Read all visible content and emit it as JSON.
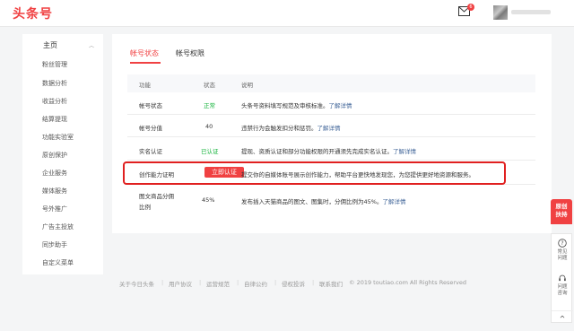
{
  "header": {
    "logo": "头条号",
    "mail_badge": "6"
  },
  "sidebar": {
    "head": "主页",
    "items": [
      {
        "label": "粉丝管理"
      },
      {
        "label": "数据分析"
      },
      {
        "label": "收益分析"
      },
      {
        "label": "结算提现"
      },
      {
        "label": "功能实验室"
      },
      {
        "label": "原创保护"
      },
      {
        "label": "企业服务"
      },
      {
        "label": "媒体服务"
      },
      {
        "label": "号外推广"
      },
      {
        "label": "广告主投放"
      },
      {
        "label": "同步助手"
      },
      {
        "label": "自定义菜单"
      }
    ]
  },
  "tabs": {
    "status": "帐号状态",
    "permissions": "帐号权限"
  },
  "table": {
    "headers": {
      "feature": "功能",
      "state": "状态",
      "desc": "说明"
    },
    "rows": [
      {
        "feature": "帐号状态",
        "state": "正常",
        "desc": "头条号资料填写规范及审核标准。",
        "link": "了解详情"
      },
      {
        "feature": "帐号分值",
        "state": "40",
        "desc": "违禁行为会触发扣分和惩罚。",
        "link": "了解详情"
      },
      {
        "feature": "实名认证",
        "state": "已认证",
        "desc": "提现、资质认证和部分功能权限的开通须先完成实名认证。",
        "link": "了解详情"
      },
      {
        "feature": "创作能力证明",
        "button": "立即认证",
        "desc": "提交你的自媒体账号展示创作能力，帮助平台更快地发现您，为您提供更好地资源和服务。"
      },
      {
        "feature_line1": "图文商品分佣",
        "feature_line2": "比例",
        "state": "45%",
        "desc": "发布插入天猫商品的图文、图集时，分佣比例为45%。",
        "link": "了解详情"
      }
    ]
  },
  "footer": {
    "links": [
      "关于今日头条",
      "用户协议",
      "运营规范",
      "自律公约",
      "侵权投诉",
      "联系我们"
    ],
    "copyright": "© 2019 toutiao.com All Rights Reserved"
  },
  "float": {
    "badge_line1": "原创",
    "badge_line2": "扶持",
    "faq_line1": "常见",
    "faq_line2": "问题",
    "consult_line1": "问题",
    "consult_line2": "咨询"
  },
  "colors": {
    "brand": "#f04142",
    "ok": "#14b33b",
    "link": "#406599"
  }
}
